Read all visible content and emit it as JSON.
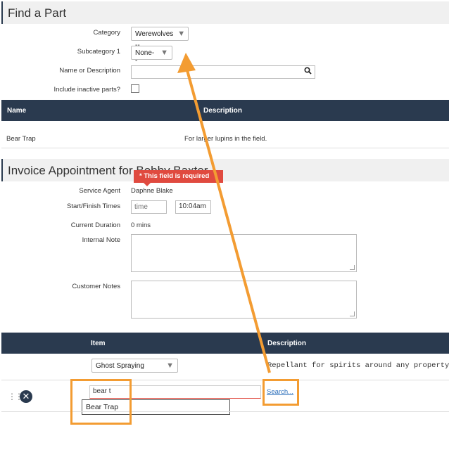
{
  "find_part": {
    "title": "Find a Part",
    "category_label": "Category",
    "category_value": "Werewolves",
    "subcategory_label": "Subcategory 1",
    "subcategory_value": "--None--",
    "name_label": "Name or Description",
    "name_value": "",
    "inactive_label": "Include inactive parts?",
    "table": {
      "headers": [
        "Name",
        "Description"
      ],
      "rows": [
        {
          "name": "Bear Trap",
          "description": "For larger lupins in the field."
        }
      ]
    }
  },
  "invoice": {
    "title": "Invoice Appointment for Bobby Baxter",
    "error_tooltip": "* This field is required",
    "service_agent_label": "Service Agent",
    "service_agent_value": "Daphne Blake",
    "times_label": "Start/Finish Times",
    "start_placeholder": "time",
    "finish_value": "10:04am",
    "duration_label": "Current Duration",
    "duration_value": "0 mins",
    "internal_note_label": "Internal Note",
    "customer_notes_label": "Customer Notes",
    "items_table": {
      "headers": [
        "Item",
        "Description"
      ],
      "row1": {
        "item": "Ghost Spraying",
        "description": "Repellant for spirits around any property - ."
      },
      "row2": {
        "item_input": "bear t",
        "search_link": "Search..."
      }
    },
    "autocomplete_option": "Bear Trap"
  },
  "colors": {
    "header_dark": "#2a3a4f",
    "error_red": "#e04a3f",
    "highlight_orange": "#f39c32",
    "link_blue": "#2a6ebb"
  },
  "icons": {
    "search": "search-icon",
    "close": "close-icon",
    "drag": "drag-handle-icon",
    "caret": "chevron-down-icon"
  }
}
